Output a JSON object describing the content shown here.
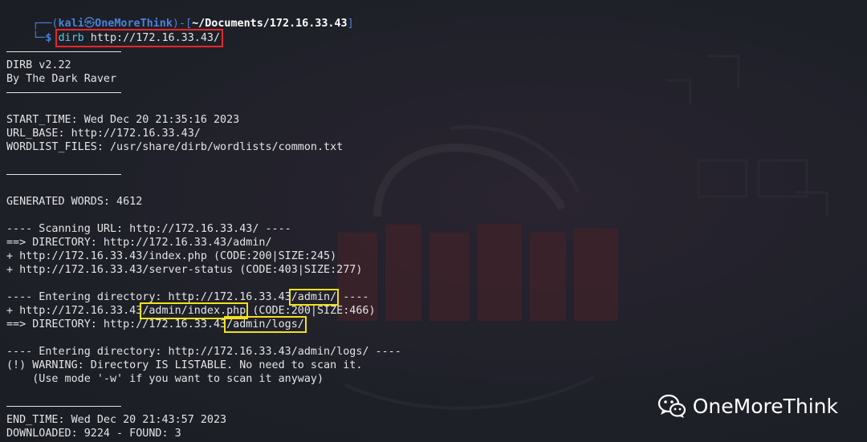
{
  "prompt": {
    "open": "┌──(",
    "user": "kali",
    "at": "㉿",
    "host": "OneMoreThink",
    "mid": ")-[",
    "path": "~/Documents/172.16.33.43",
    "close": "]",
    "corner": "└─",
    "dollar": "$",
    "command_name": "dirb",
    "command_arg": " http://172.16.33.43/"
  },
  "banner": {
    "name": "DIRB v2.22",
    "author": "By The Dark Raver"
  },
  "info": {
    "start_time": "START_TIME: Wed Dec 20 21:35:16 2023",
    "url_base": "URL_BASE: http://172.16.33.43/",
    "wordlist": "WORDLIST_FILES: /usr/share/dirb/wordlists/common.txt"
  },
  "generated": "GENERATED WORDS: 4612",
  "scan1": {
    "header": "---- Scanning URL: http://172.16.33.43/ ----",
    "dir": "==> DIRECTORY: http://172.16.33.43/admin/",
    "hit1": "+ http://172.16.33.43/index.php (CODE:200|SIZE:245)",
    "hit2": "+ http://172.16.33.43/server-status (CODE:403|SIZE:277)"
  },
  "scan2": {
    "header_pre": "---- Entering directory: http://172.16.33.43",
    "header_hl": "/admin/",
    "header_post": " ----",
    "hit_pre": "+ http://172.16.33.43",
    "hit_hl": "/admin/index.php",
    "hit_post": " (CODE:200|SIZE:466)",
    "dir_pre": "==> DIRECTORY: http://172.16.33.43",
    "dir_hl": "/admin/logs/"
  },
  "scan3": {
    "header": "---- Entering directory: http://172.16.33.43/admin/logs/ ----",
    "warning": "(!) WARNING: Directory IS LISTABLE. No need to scan it.",
    "hint": "    (Use mode '-w' if you want to scan it anyway)"
  },
  "end": {
    "end_time": "END_TIME: Wed Dec 20 21:43:57 2023",
    "downloaded": "DOWNLOADED: 9224 - FOUND: 3"
  },
  "watermark": {
    "text": "OneMoreThink",
    "icon": "wechat-icon"
  },
  "colors": {
    "background": "#1f2129",
    "prompt_blue": "#4a82d6",
    "command_cyan": "#5fc3e4",
    "highlight_red": "#e8262a",
    "highlight_yellow": "#f3e01a"
  }
}
